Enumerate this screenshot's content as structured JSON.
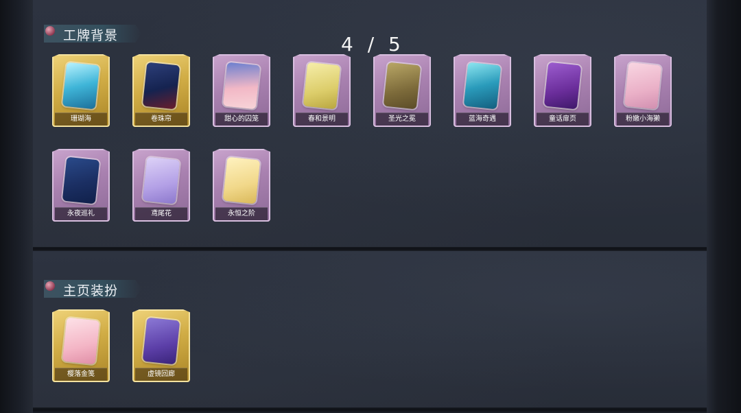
{
  "sections": {
    "badge_bg": {
      "title": "工牌背景",
      "counter": "4 / 5",
      "items": [
        {
          "name": "珊瑚海",
          "frame": "gold",
          "art": "coral-icon"
        },
        {
          "name": "卷珠帘",
          "frame": "gold",
          "art": "pearl-curtain-icon"
        },
        {
          "name": "甜心的囚笼",
          "frame": "purple",
          "art": "sweetheart-cage-icon"
        },
        {
          "name": "春和景明",
          "frame": "purple",
          "art": "spring-icon"
        },
        {
          "name": "圣光之冕",
          "frame": "purple",
          "art": "holy-crown-icon"
        },
        {
          "name": "蓝海奇遇",
          "frame": "purple",
          "art": "blue-sea-icon"
        },
        {
          "name": "童话扉页",
          "frame": "purple",
          "art": "fairy-page-icon"
        },
        {
          "name": "粉嫩小海獭",
          "frame": "purple",
          "art": "pink-otter-icon"
        },
        {
          "name": "永夜巡礼",
          "frame": "purple",
          "art": "night-pilgrimage-icon"
        },
        {
          "name": "鸢尾花",
          "frame": "purple",
          "art": "iris-icon"
        },
        {
          "name": "永恒之阶",
          "frame": "purple",
          "art": "eternal-steps-icon"
        }
      ]
    },
    "home_decor": {
      "title": "主页装扮",
      "items": [
        {
          "name": "樱落金笺",
          "frame": "gold",
          "art": "sakura-letter-icon"
        },
        {
          "name": "虚镜回廊",
          "frame": "gold",
          "art": "mirror-corridor-icon"
        }
      ]
    }
  }
}
